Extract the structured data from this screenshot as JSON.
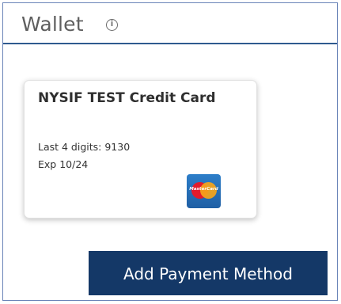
{
  "wallet": {
    "title": "Wallet",
    "info_icon": "info-icon",
    "info_symbol": "i"
  },
  "card": {
    "name": "NYSIF TEST Credit Card",
    "last4_label": "Last 4 digits: 9130",
    "expiry_label": "Exp 10/24",
    "brand_icon": "mastercard-logo",
    "brand_text": "MasterCard"
  },
  "actions": {
    "add_payment_method_label": "Add Payment Method"
  },
  "colors": {
    "header_rule": "#2f5a8f",
    "button_bg": "#143867",
    "button_text": "#ffffff",
    "title_text": "#5f5f5f"
  }
}
